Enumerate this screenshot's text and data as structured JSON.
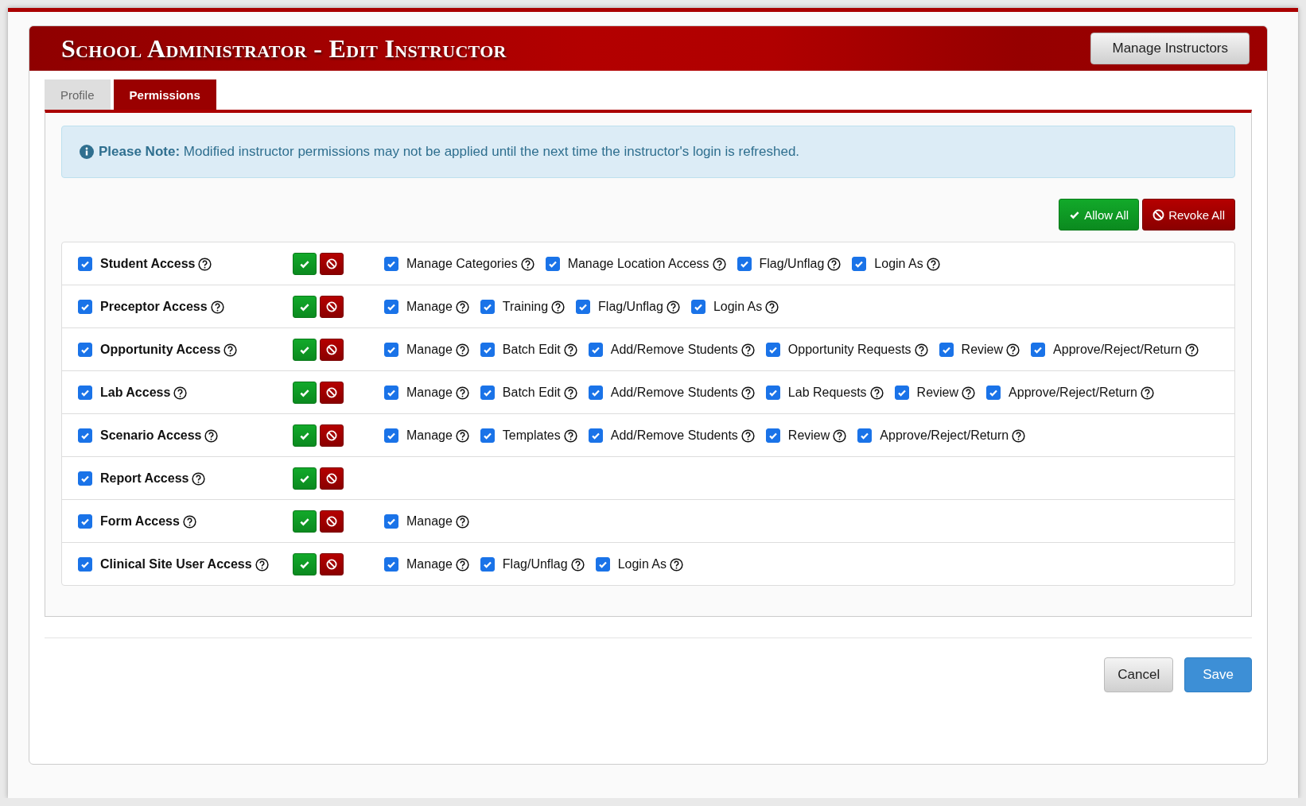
{
  "header": {
    "title": "School Administrator - Edit Instructor",
    "action": "Manage Instructors"
  },
  "tabs": [
    {
      "label": "Profile",
      "selected": false
    },
    {
      "label": "Permissions",
      "selected": true
    }
  ],
  "note": {
    "label": "Please Note:",
    "text": "Modified instructor permissions may not be applied until the next time the instructor's login is refreshed."
  },
  "bulk_actions": {
    "allow": "Allow All",
    "revoke": "Revoke All"
  },
  "permissions": [
    {
      "label": "Student Access",
      "checked": true,
      "options": [
        {
          "label": "Manage Categories",
          "checked": true
        },
        {
          "label": "Manage Location Access",
          "checked": true
        },
        {
          "label": "Flag/Unflag",
          "checked": true
        },
        {
          "label": "Login As",
          "checked": true
        }
      ]
    },
    {
      "label": "Preceptor Access",
      "checked": true,
      "options": [
        {
          "label": "Manage",
          "checked": true
        },
        {
          "label": "Training",
          "checked": true
        },
        {
          "label": "Flag/Unflag",
          "checked": true
        },
        {
          "label": "Login As",
          "checked": true
        }
      ]
    },
    {
      "label": "Opportunity Access",
      "checked": true,
      "options": [
        {
          "label": "Manage",
          "checked": true
        },
        {
          "label": "Batch Edit",
          "checked": true
        },
        {
          "label": "Add/Remove Students",
          "checked": true
        },
        {
          "label": "Opportunity Requests",
          "checked": true
        },
        {
          "label": "Review",
          "checked": true
        },
        {
          "label": "Approve/Reject/Return",
          "checked": true
        }
      ]
    },
    {
      "label": "Lab Access",
      "checked": true,
      "options": [
        {
          "label": "Manage",
          "checked": true
        },
        {
          "label": "Batch Edit",
          "checked": true
        },
        {
          "label": "Add/Remove Students",
          "checked": true
        },
        {
          "label": "Lab Requests",
          "checked": true
        },
        {
          "label": "Review",
          "checked": true
        },
        {
          "label": "Approve/Reject/Return",
          "checked": true
        }
      ]
    },
    {
      "label": "Scenario Access",
      "checked": true,
      "options": [
        {
          "label": "Manage",
          "checked": true
        },
        {
          "label": "Templates",
          "checked": true
        },
        {
          "label": "Add/Remove Students",
          "checked": true
        },
        {
          "label": "Review",
          "checked": true
        },
        {
          "label": "Approve/Reject/Return",
          "checked": true
        }
      ]
    },
    {
      "label": "Report Access",
      "checked": true
    },
    {
      "label": "Form Access",
      "checked": true,
      "options": [
        {
          "label": "Manage",
          "checked": true
        }
      ]
    },
    {
      "label": "Clinical Site User Access",
      "checked": true,
      "options": [
        {
          "label": "Manage",
          "checked": true
        },
        {
          "label": "Flag/Unflag",
          "checked": true
        },
        {
          "label": "Login As",
          "checked": true
        }
      ]
    }
  ],
  "footer": {
    "cancel": "Cancel",
    "save": "Save"
  }
}
